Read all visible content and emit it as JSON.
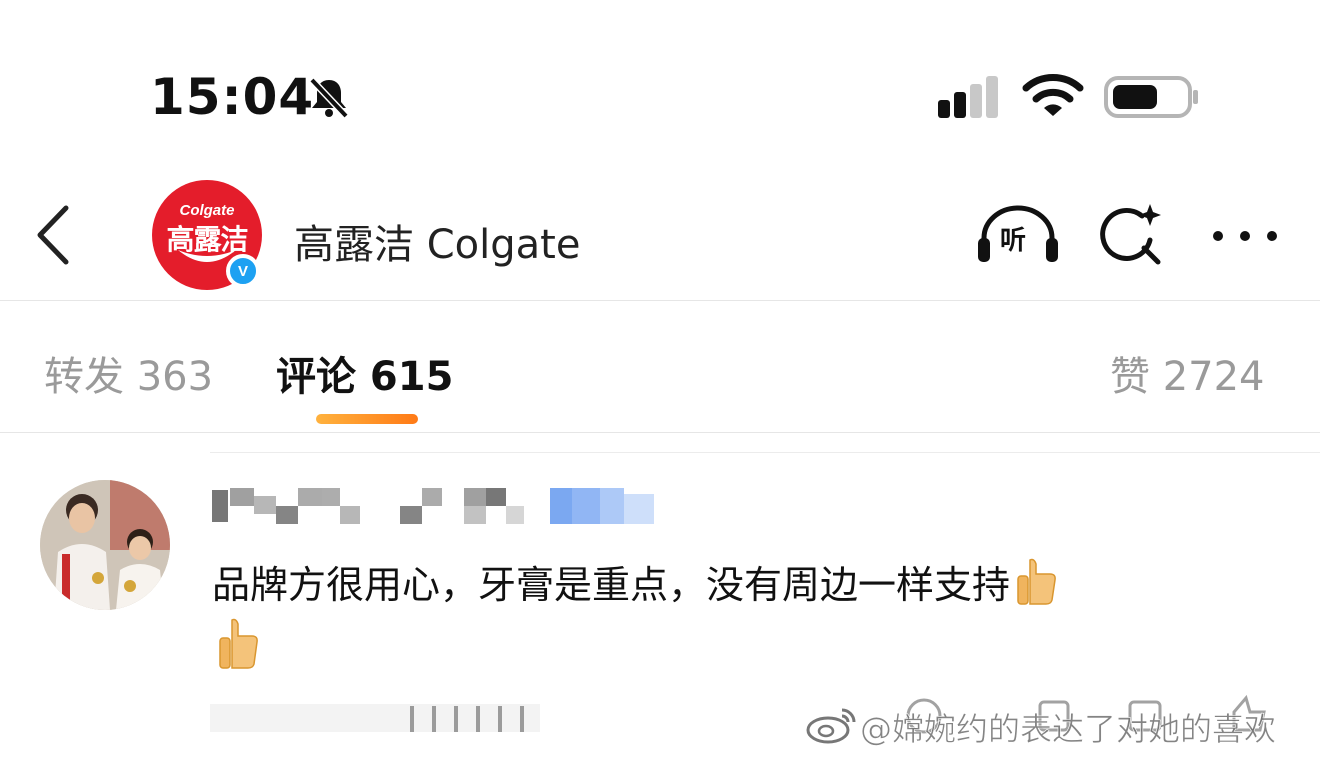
{
  "status_bar": {
    "time": "15:04",
    "icons": [
      "bell-muted-icon",
      "cellular-signal-icon",
      "wifi-icon",
      "battery-icon"
    ]
  },
  "header": {
    "back_icon": "chevron-left-icon",
    "account_name": "高露洁 Colgate",
    "avatar_brand_top": "Colgate",
    "avatar_brand_cn": "高露洁",
    "verified_badge": "V",
    "listen_label": "听",
    "actions": [
      "listen-icon",
      "search-icon",
      "more-icon"
    ]
  },
  "tabs": {
    "repost": "转发 363",
    "comments": "评论 615",
    "likes": "赞 2724",
    "active": "comments"
  },
  "comment": {
    "text": "品牌方很用心，牙膏是重点，没有周边一样支持",
    "emoji": [
      "thumbs-up-icon",
      "thumbs-up-icon"
    ]
  },
  "watermark": {
    "text": "@嫦婉约的表达了对她的喜欢"
  },
  "colors": {
    "brand_red": "#e41d2b",
    "verified_blue": "#1da1f2",
    "tab_indicator": "#ff8c1a",
    "muted_text": "#9a9a9a"
  }
}
